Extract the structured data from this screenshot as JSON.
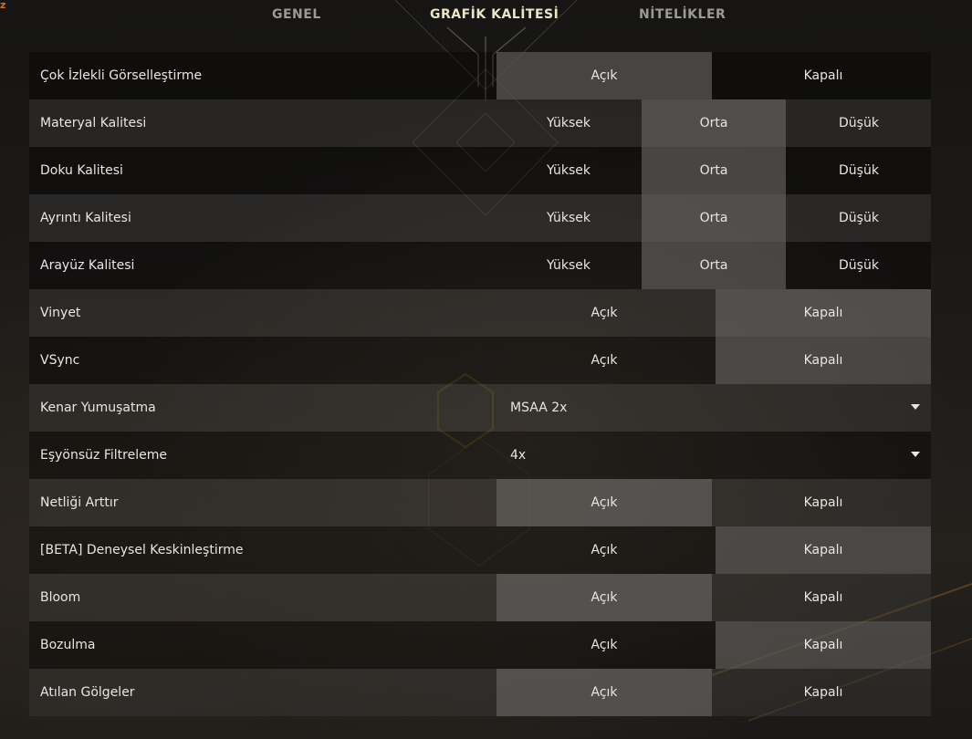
{
  "tabs": [
    {
      "label": "GENEL",
      "active": false
    },
    {
      "label": "GRAFİK KALİTESİ",
      "active": true
    },
    {
      "label": "NİTELİKLER",
      "active": false
    }
  ],
  "settings": [
    {
      "label": "Çok İzlekli Görselleştirme",
      "options": [
        "Açık",
        "Kapalı"
      ],
      "selected": "Açık"
    },
    {
      "label": "Materyal Kalitesi",
      "options": [
        "Yüksek",
        "Orta",
        "Düşük"
      ],
      "selected": "Orta"
    },
    {
      "label": "Doku Kalitesi",
      "options": [
        "Yüksek",
        "Orta",
        "Düşük"
      ],
      "selected": "Orta"
    },
    {
      "label": "Ayrıntı Kalitesi",
      "options": [
        "Yüksek",
        "Orta",
        "Düşük"
      ],
      "selected": "Orta"
    },
    {
      "label": "Arayüz Kalitesi",
      "options": [
        "Yüksek",
        "Orta",
        "Düşük"
      ],
      "selected": "Orta"
    },
    {
      "label": "Vinyet",
      "options": [
        "Açık",
        "Kapalı"
      ],
      "selected": "Kapalı"
    },
    {
      "label": "VSync",
      "options": [
        "Açık",
        "Kapalı"
      ],
      "selected": "Kapalı"
    },
    {
      "label": "Kenar Yumuşatma",
      "dropdown": "MSAA 2x"
    },
    {
      "label": "Eşyönsüz Filtreleme",
      "dropdown": "4x"
    },
    {
      "label": "Netliği Arttır",
      "options": [
        "Açık",
        "Kapalı"
      ],
      "selected": "Açık"
    },
    {
      "label": "[BETA] Deneysel Keskinleştirme",
      "options": [
        "Açık",
        "Kapalı"
      ],
      "selected": "Kapalı"
    },
    {
      "label": "Bloom",
      "options": [
        "Açık",
        "Kapalı"
      ],
      "selected": "Açık"
    },
    {
      "label": "Bozulma",
      "options": [
        "Açık",
        "Kapalı"
      ],
      "selected": "Kapalı"
    },
    {
      "label": "Atılan Gölgeler",
      "options": [
        "Açık",
        "Kapalı"
      ],
      "selected": "Açık"
    }
  ],
  "colors": {
    "active_tab": "#eae4c8",
    "inactive_tab": "#9c9a97",
    "selected_option": "#6a6864",
    "accent": "#e06a1a"
  }
}
